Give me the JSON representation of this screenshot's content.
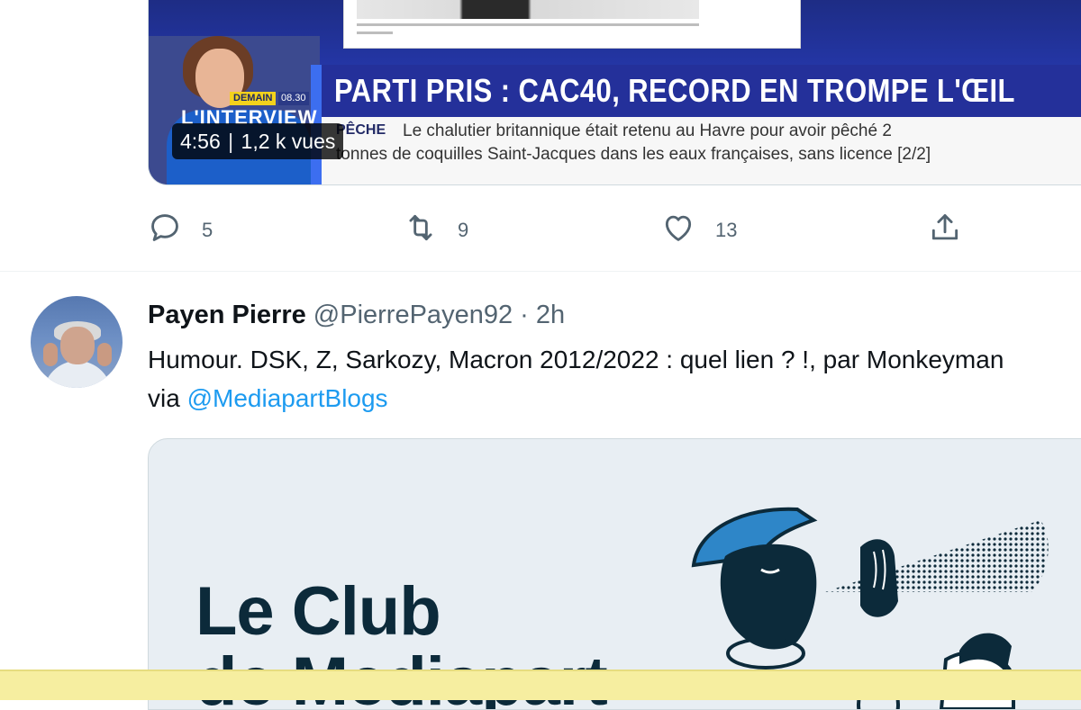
{
  "video": {
    "duration": "4:56",
    "views": "1,2 k vues",
    "headline": "PARTI PRIS : CAC40, RECORD EN TROMPE L'ŒIL",
    "ticker_tag": "PÊCHE",
    "ticker_line1": "Le chalutier britannique était retenu au Havre pour avoir pêché 2",
    "ticker_line2": "tonnes de coquilles Saint-Jacques dans les eaux françaises, sans licence [2/2]",
    "demain_label": "DEMAIN",
    "show_time": "08.30",
    "show_name": "L'INTERVIEW"
  },
  "actions": {
    "reply_count": "5",
    "retweet_count": "9",
    "like_count": "13"
  },
  "tweet": {
    "name": "Payen Pierre",
    "handle": "@PierrePayen92",
    "dot": "·",
    "time": "2h",
    "text": "Humour. DSK, Z, Sarkozy, Macron 2012/2022 : quel lien ? !, par Monkeyman via ",
    "mention": "@MediapartBlogs"
  },
  "link_card": {
    "title_line1": "Le Club",
    "title_line2": "de Mediapart"
  },
  "colors": {
    "accent": "#1d9bf0",
    "muted": "#536471",
    "text": "#0f1419"
  },
  "icons": [
    "reply-icon",
    "retweet-icon",
    "like-icon",
    "share-icon"
  ]
}
